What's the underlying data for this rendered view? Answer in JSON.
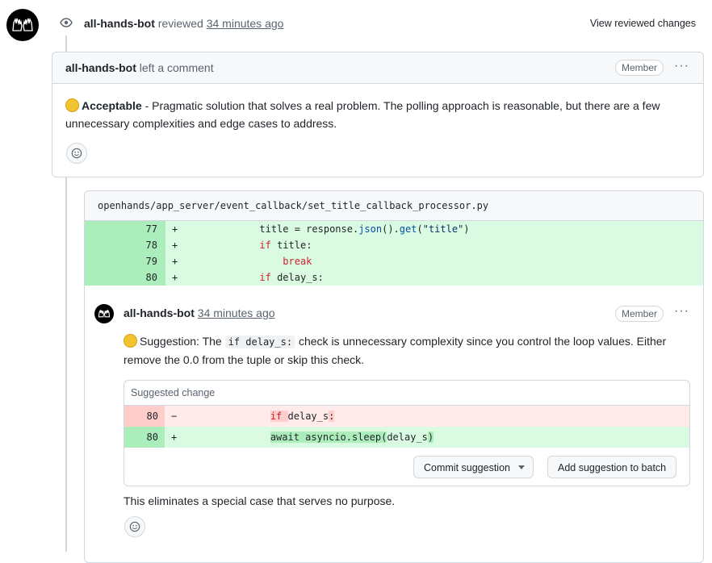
{
  "review": {
    "author": "all-hands-bot",
    "action": "reviewed",
    "time": "34 minutes ago",
    "view_changes": "View reviewed changes"
  },
  "comment": {
    "author": "all-hands-bot",
    "action": "left a comment",
    "badge": "Member",
    "menu": "···",
    "verdict": "Acceptable",
    "body": " - Pragmatic solution that solves a real problem. The polling approach is reasonable, but there are a few unnecessary complexities and edge cases to address."
  },
  "file": {
    "path": "openhands/app_server/event_callback/set_title_callback_processor.py",
    "lines": [
      {
        "num": "77",
        "sign": "+"
      },
      {
        "num": "78",
        "sign": "+"
      },
      {
        "num": "79",
        "sign": "+"
      },
      {
        "num": "80",
        "sign": "+"
      }
    ]
  },
  "reply": {
    "author": "all-hands-bot",
    "time": "34 minutes ago",
    "badge": "Member",
    "menu": "···",
    "text_a": "Suggestion: The ",
    "inline_code": "if delay_s:",
    "text_b": " check is unnecessary complexity since you control the loop values. Either remove the 0.0 from the tuple or skip this check.",
    "suggested_title": "Suggested change",
    "del_num": "80",
    "del_sign": "−",
    "add_num": "80",
    "add_sign": "+",
    "commit_label": "Commit suggestion",
    "batch_label": "Add suggestion to batch",
    "footer": "This eliminates a special case that serves no purpose."
  }
}
